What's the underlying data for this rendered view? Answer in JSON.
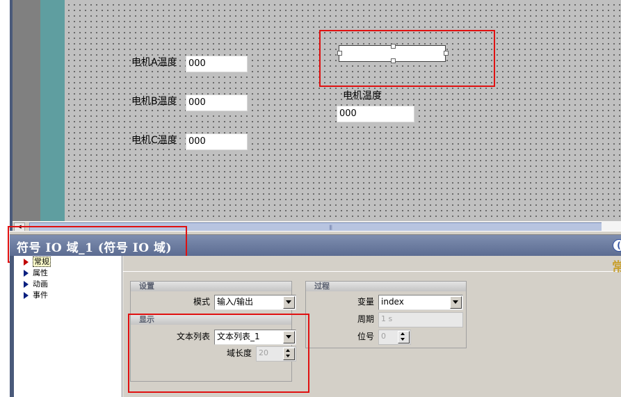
{
  "canvas": {
    "motor_a_label": "电机A温度",
    "motor_a_value": "000",
    "motor_b_label": "电机B温度",
    "motor_b_value": "000",
    "motor_c_label": "电机C温度",
    "motor_c_value": "000",
    "motor_temp_label": "电机温度",
    "motor_temp_value": "000"
  },
  "inspector": {
    "title": "符号 IO 域_1 (符号 IO 域)",
    "help_glyph": "(",
    "corner_text": "常",
    "tree": [
      {
        "label": "常规",
        "selected": true
      },
      {
        "label": "属性",
        "selected": false
      },
      {
        "label": "动画",
        "selected": false
      },
      {
        "label": "事件",
        "selected": false
      }
    ],
    "settings_group": {
      "header": "设置",
      "mode_label": "模式",
      "mode_value": "输入/输出"
    },
    "display_group": {
      "header": "显示",
      "textlist_label": "文本列表",
      "textlist_value": "文本列表_1",
      "fieldlen_label": "域长度",
      "fieldlen_value": "20"
    },
    "process_group": {
      "header": "过程",
      "var_label": "变量",
      "var_value": "index",
      "cycle_label": "周期",
      "cycle_value": "1 s",
      "bit_label": "位号",
      "bit_value": "0"
    }
  },
  "colors": {
    "highlight_box": "#e01010",
    "canvas_bg": "#c0c0c0",
    "title_bar": "#6a7aa0"
  }
}
